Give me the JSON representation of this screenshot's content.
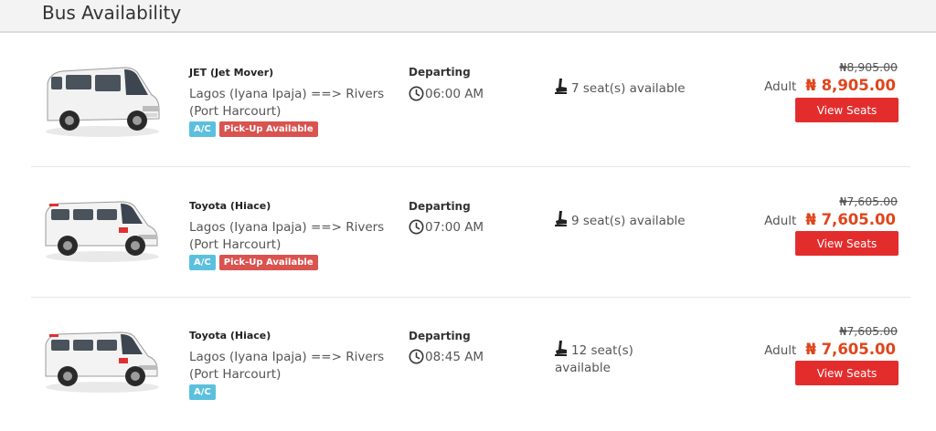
{
  "header": {
    "title": "Bus Availability"
  },
  "colors": {
    "accent": "#e32d2d",
    "price": "#e0451c",
    "tag_ac": "#5bc0de",
    "tag_pickup": "#d9534f"
  },
  "trips": [
    {
      "bus_name": "JET (Jet Mover)",
      "bus_image": "jet-mover-van-image",
      "route": "Lagos (Iyana Ipaja) ==> Rivers (Port Harcourt)",
      "tags": [
        "A/C",
        "Pick-Up Available"
      ],
      "departing_label": "Departing",
      "departure_time": "06:00 AM",
      "seats": "7 seat(s) available",
      "old_price": "₦8,905.00",
      "adult_label": "Adult",
      "price": "₦ 8,905.00",
      "button_label": "View Seats"
    },
    {
      "bus_name": "Toyota (Hiace)",
      "bus_image": "toyota-hiace-van-image",
      "route": "Lagos (Iyana Ipaja) ==> Rivers (Port Harcourt)",
      "tags": [
        "A/C",
        "Pick-Up Available"
      ],
      "departing_label": "Departing",
      "departure_time": "07:00 AM",
      "seats": "9 seat(s) available",
      "old_price": "₦7,605.00",
      "adult_label": "Adult",
      "price": "₦ 7,605.00",
      "button_label": "View Seats"
    },
    {
      "bus_name": "Toyota (Hiace)",
      "bus_image": "toyota-hiace-van-image",
      "route": "Lagos (Iyana Ipaja) ==> Rivers (Port Harcourt)",
      "tags": [
        "A/C"
      ],
      "departing_label": "Departing",
      "departure_time": "08:45 AM",
      "seats": "12 seat(s) available",
      "old_price": "₦7,605.00",
      "adult_label": "Adult",
      "price": "₦ 7,605.00",
      "button_label": "View Seats"
    }
  ]
}
